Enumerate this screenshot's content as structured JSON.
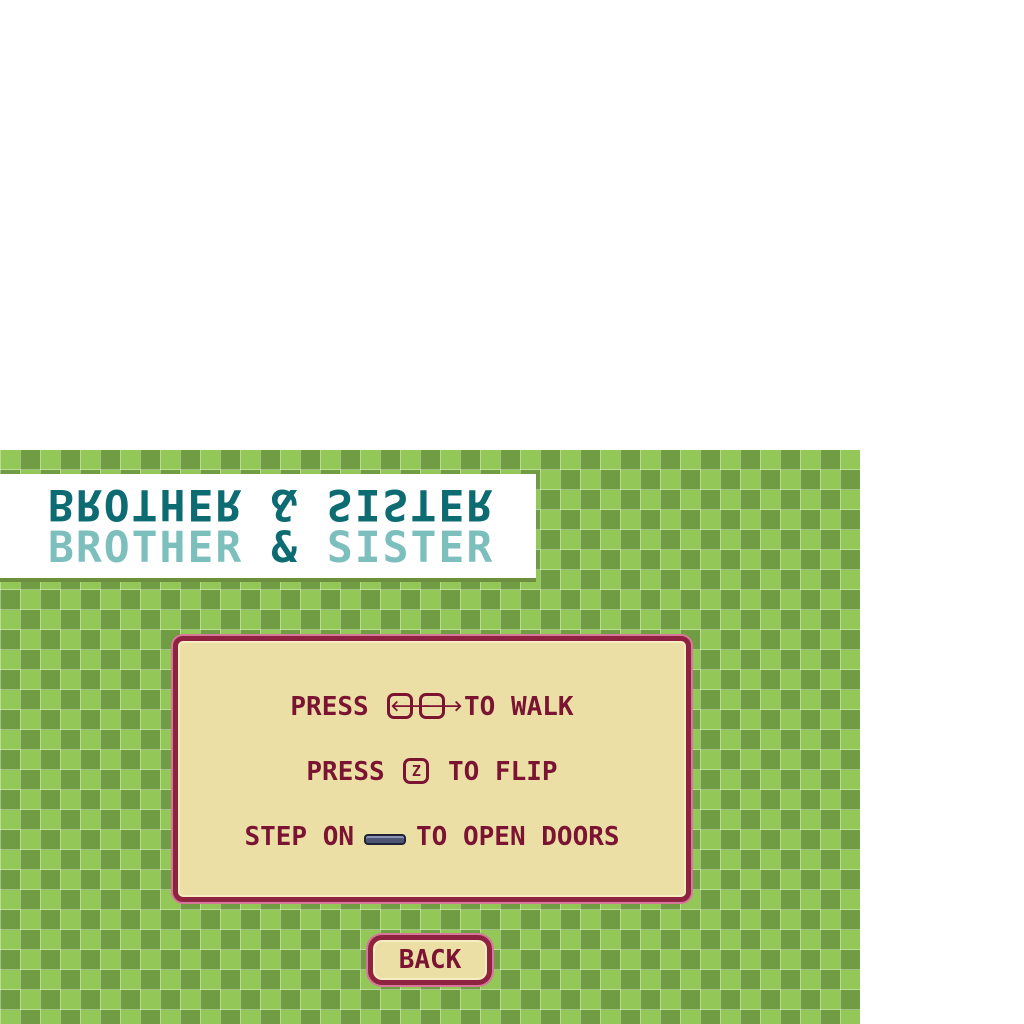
{
  "title": {
    "part1": "BROTHER",
    "amp": "&",
    "part2": "SISTER"
  },
  "instructions": {
    "walk_prefix": "PRESS",
    "left_key": "🡐",
    "right_key": "🡒",
    "walk_suffix": "TO WALK",
    "flip_prefix": "PRESS",
    "flip_key": "Z",
    "flip_suffix": "TO FLIP",
    "door_prefix": "STEP ON",
    "door_suffix": "TO OPEN DOORS"
  },
  "back_label": "BACK",
  "icons": {
    "left_key": "left-arrow-key-icon",
    "right_key": "right-arrow-key-icon",
    "flip_key": "z-key-icon",
    "plate": "pressure-plate-icon"
  },
  "colors": {
    "grass_light": "#93c858",
    "grass_dark": "#709c44",
    "title_dark": "#0d6b72",
    "title_light": "#7dbfbd",
    "panel_bg": "#ebdfa6",
    "panel_border": "#8e2341",
    "text": "#7a1432"
  }
}
